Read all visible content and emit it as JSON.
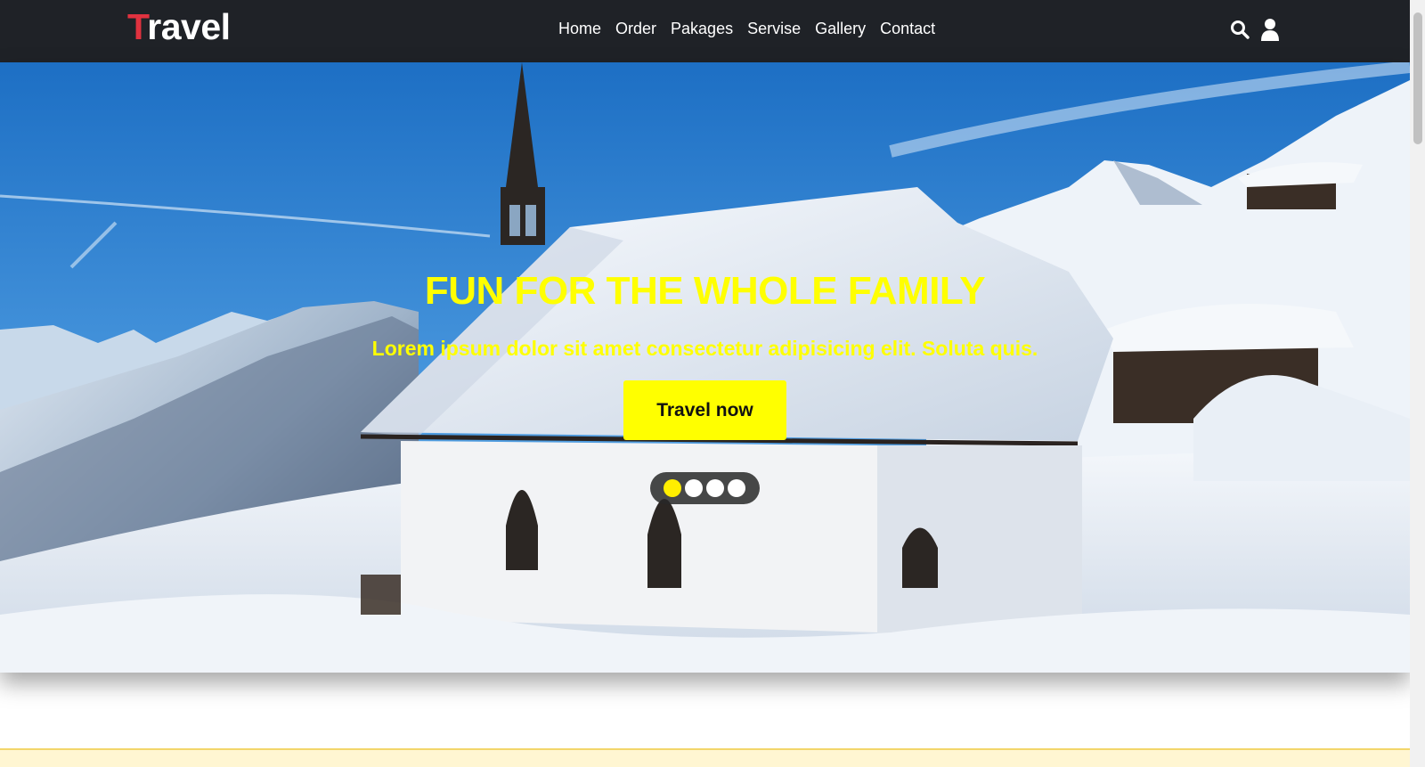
{
  "brand": {
    "first_letter": "T",
    "rest": "ravel"
  },
  "nav": {
    "links": [
      "Home",
      "Order",
      "Pakages",
      "Servise",
      "Gallery",
      "Contact"
    ],
    "icons": [
      "search-icon",
      "user-icon"
    ]
  },
  "hero": {
    "title": "FUN FOR THE WHOLE FAMILY",
    "subtitle": "Lorem ipsum dolor sit amet consectetur adipisicing elit. Soluta quis.",
    "cta_label": "Travel now",
    "slides_count": 4,
    "active_slide": 1
  },
  "colors": {
    "nav_bg": "#1f2227",
    "brand_accent": "#e0323f",
    "hero_text": "#ffff00",
    "button_bg": "#ffff00",
    "active_dot": "#ffee00"
  }
}
